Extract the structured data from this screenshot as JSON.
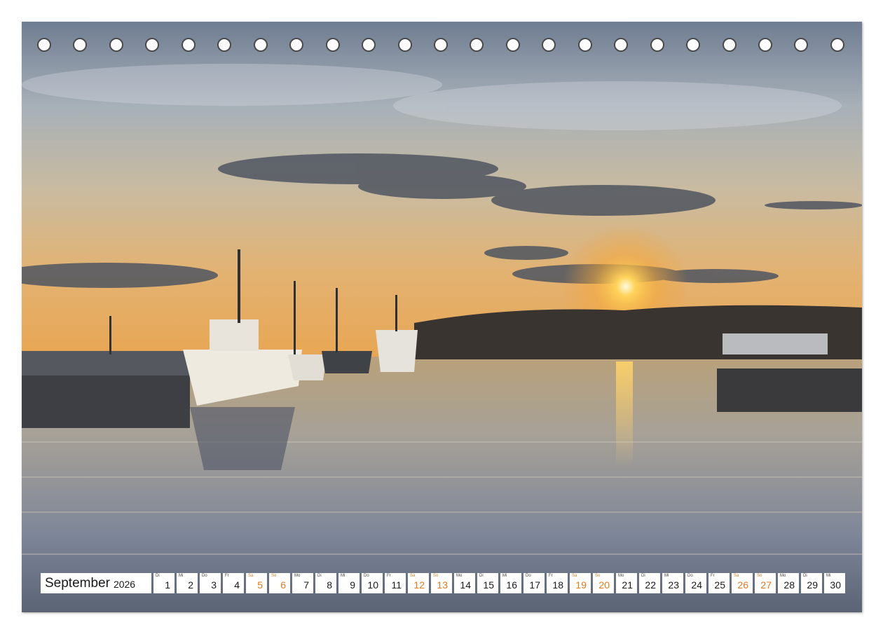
{
  "calendar": {
    "month": "September",
    "year": "2026",
    "weekend_color": "#e07a1f",
    "days": [
      {
        "num": "1",
        "dow": "Di",
        "weekend": false
      },
      {
        "num": "2",
        "dow": "Mi",
        "weekend": false
      },
      {
        "num": "3",
        "dow": "Do",
        "weekend": false
      },
      {
        "num": "4",
        "dow": "Fr",
        "weekend": false
      },
      {
        "num": "5",
        "dow": "Sa",
        "weekend": true
      },
      {
        "num": "6",
        "dow": "So",
        "weekend": true
      },
      {
        "num": "7",
        "dow": "Mo",
        "weekend": false
      },
      {
        "num": "8",
        "dow": "Di",
        "weekend": false
      },
      {
        "num": "9",
        "dow": "Mi",
        "weekend": false
      },
      {
        "num": "10",
        "dow": "Do",
        "weekend": false
      },
      {
        "num": "11",
        "dow": "Fr",
        "weekend": false
      },
      {
        "num": "12",
        "dow": "Sa",
        "weekend": true
      },
      {
        "num": "13",
        "dow": "So",
        "weekend": true
      },
      {
        "num": "14",
        "dow": "Mo",
        "weekend": false
      },
      {
        "num": "15",
        "dow": "Di",
        "weekend": false
      },
      {
        "num": "16",
        "dow": "Mi",
        "weekend": false
      },
      {
        "num": "17",
        "dow": "Do",
        "weekend": false
      },
      {
        "num": "18",
        "dow": "Fr",
        "weekend": false
      },
      {
        "num": "19",
        "dow": "Sa",
        "weekend": true
      },
      {
        "num": "20",
        "dow": "So",
        "weekend": true
      },
      {
        "num": "21",
        "dow": "Mo",
        "weekend": false
      },
      {
        "num": "22",
        "dow": "Di",
        "weekend": false
      },
      {
        "num": "23",
        "dow": "Mi",
        "weekend": false
      },
      {
        "num": "24",
        "dow": "Do",
        "weekend": false
      },
      {
        "num": "25",
        "dow": "Fr",
        "weekend": false
      },
      {
        "num": "26",
        "dow": "Sa",
        "weekend": true
      },
      {
        "num": "27",
        "dow": "So",
        "weekend": true
      },
      {
        "num": "28",
        "dow": "Mo",
        "weekend": false
      },
      {
        "num": "29",
        "dow": "Di",
        "weekend": false
      },
      {
        "num": "30",
        "dow": "Mi",
        "weekend": false
      }
    ]
  },
  "binding_holes": {
    "count": 23
  }
}
